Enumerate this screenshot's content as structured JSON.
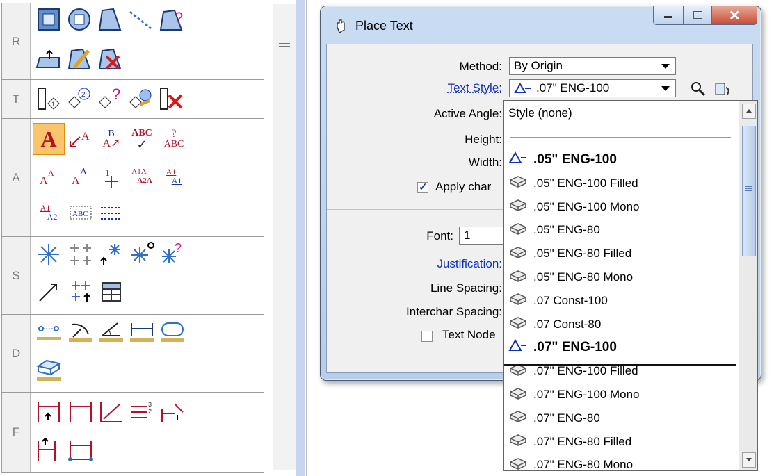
{
  "palette": {
    "groups": [
      {
        "letter": "R"
      },
      {
        "letter": "T"
      },
      {
        "letter": "A"
      },
      {
        "letter": "S"
      },
      {
        "letter": "D"
      },
      {
        "letter": "F"
      }
    ],
    "text_tools": {
      "place_text": "A",
      "abc": "ABC",
      "abc2": "ABC",
      "b": "B",
      "q": "?",
      "a1a": "A1A",
      "a2a": "A2A",
      "a1": "A1",
      "a2": "A2"
    }
  },
  "dialog": {
    "title": "Place Text",
    "method_label": "Method:",
    "method_value": "By Origin",
    "text_style_label": "Text Style:",
    "text_style_value": ".07\"  ENG-100",
    "active_angle_label": "Active Angle:",
    "height_label": "Height:",
    "width_label": "Width:",
    "apply_changes_label": "Apply char",
    "font_label": "Font:",
    "font_value": "1",
    "justification_label": "Justification:",
    "line_spacing_label": "Line Spacing:",
    "interchar_spacing_label": "Interchar Spacing:",
    "text_node_label": "Text Node"
  },
  "dropdown": {
    "first_item": "Style (none)",
    "items": [
      {
        "label": ".05\"  ENG-100",
        "style": "bold",
        "icon": "style-active-icon"
      },
      {
        "label": ".05\"  ENG-100 Filled",
        "style": "normal",
        "icon": "style-icon"
      },
      {
        "label": ".05\"  ENG-100 Mono",
        "style": "normal",
        "icon": "style-icon"
      },
      {
        "label": ".05\"  ENG-80",
        "style": "normal",
        "icon": "style-icon"
      },
      {
        "label": ".05\"  ENG-80 Filled",
        "style": "normal",
        "icon": "style-icon"
      },
      {
        "label": ".05\"  ENG-80 Mono",
        "style": "normal",
        "icon": "style-icon"
      },
      {
        "label": ".07 Const-100",
        "style": "normal",
        "icon": "style-icon"
      },
      {
        "label": ".07 Const-80",
        "style": "normal",
        "icon": "style-icon"
      },
      {
        "label": ".07\"  ENG-100",
        "style": "bold",
        "icon": "style-active-icon"
      },
      {
        "label": ".07\"  ENG-100 Filled",
        "style": "normal",
        "icon": "style-icon"
      },
      {
        "label": ".07\"  ENG-100 Mono",
        "style": "normal",
        "icon": "style-icon"
      },
      {
        "label": ".07\"  ENG-80",
        "style": "normal",
        "icon": "style-icon"
      },
      {
        "label": ".07\"  ENG-80 Filled",
        "style": "normal",
        "icon": "style-icon"
      },
      {
        "label": ".07\"  ENG-80 Mono",
        "style": "normal",
        "icon": "style-icon"
      }
    ]
  },
  "colors": {
    "accent_blue": "#1030b8",
    "text_red": "#b3122b",
    "selected_tool": "#fbc66a",
    "close_button": "#c74b36"
  }
}
